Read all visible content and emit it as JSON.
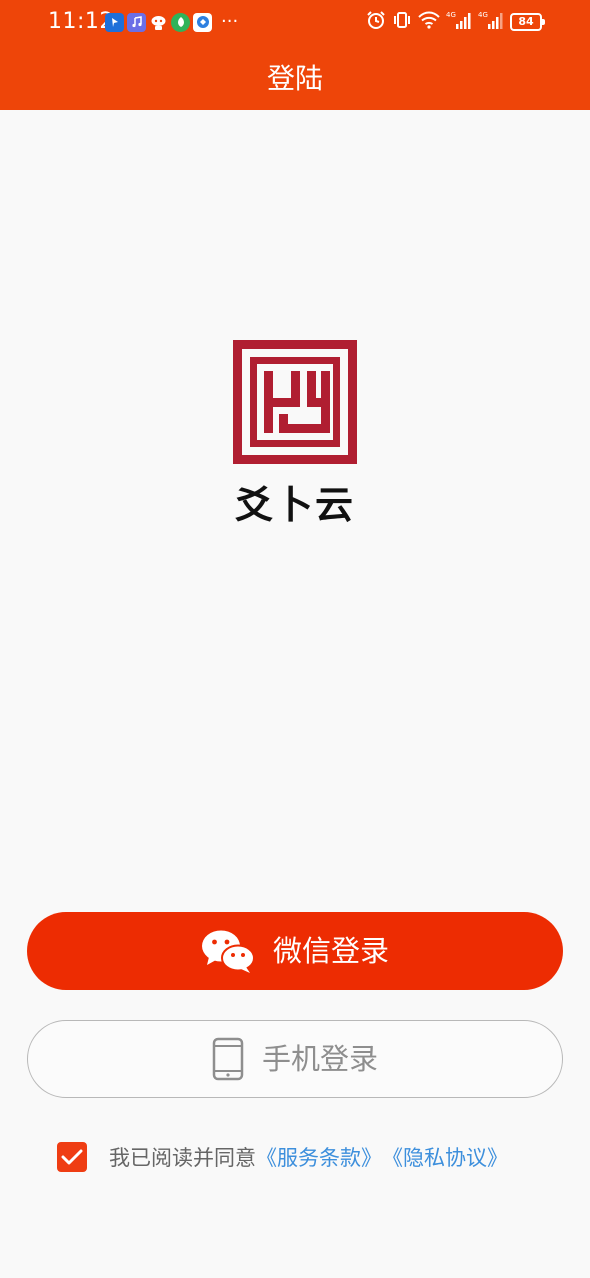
{
  "status_bar": {
    "time": "11:12",
    "more": "···",
    "battery": "84",
    "network": "4G"
  },
  "header": {
    "title": "登陆"
  },
  "logo": {
    "name": "爻卜云"
  },
  "buttons": {
    "wechat_label": "微信登录",
    "phone_label": "手机登录"
  },
  "agreement": {
    "checked": true,
    "text": "我已阅读并同意",
    "terms_link": "《服务条款》",
    "privacy_link": "《隐私协议》"
  },
  "colors": {
    "header_bg": "#ee4509",
    "wechat_button": "#ed2c02",
    "checkbox": "#ef3d13",
    "link": "#3d8fdc",
    "logo_red": "#b01e31"
  },
  "icons": {
    "wechat": "wechat-icon",
    "phone": "mobile-phone-icon",
    "check": "checkmark-icon"
  }
}
